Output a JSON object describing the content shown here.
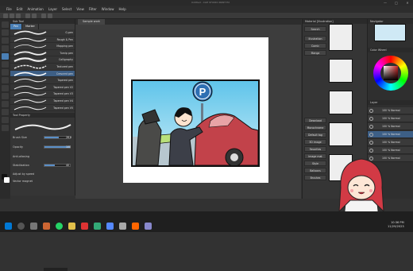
{
  "window": {
    "title": "Untitled - CLIP STUDIO PAINT EX",
    "controls": [
      "—",
      "□",
      "✕"
    ]
  },
  "menu": [
    "File",
    "Edit",
    "Animation",
    "Layer",
    "Select",
    "View",
    "Filter",
    "Window",
    "Help"
  ],
  "canvas_tab": {
    "label": "Sample work"
  },
  "brush_panel": {
    "header": "Sub Tool",
    "tabs": [
      "Pen",
      "Marker"
    ],
    "brushes": [
      {
        "label": "G-pen"
      },
      {
        "label": "Rough & Pen"
      },
      {
        "label": "Mapping pen"
      },
      {
        "label": "Turnip pen"
      },
      {
        "label": "Calligraphy"
      },
      {
        "label": "Textured pen"
      },
      {
        "label": "Crescent pen"
      },
      {
        "label": "Tapered pen"
      },
      {
        "label": "Tapered pen V2"
      },
      {
        "label": "Tapered pen V3"
      },
      {
        "label": "Tapered pen V4"
      },
      {
        "label": "Tapered pen V5"
      }
    ]
  },
  "tool_property": {
    "header": "Tool Property",
    "rows": [
      {
        "label": "Brush Size",
        "value": "26.0"
      },
      {
        "label": "Opacity",
        "value": "100"
      },
      {
        "label": "Anti-aliasing",
        "value": ""
      },
      {
        "label": "Stabilization",
        "value": "40"
      },
      {
        "label": "Adjust by speed",
        "value": ""
      },
      {
        "label": "Vector magnet",
        "value": ""
      }
    ]
  },
  "illustration": {
    "sign_letter": "P"
  },
  "material_panel": {
    "header": "Material [Illustration]",
    "side_buttons": [
      "Search",
      "Illustration",
      "Comic",
      "Manga",
      "Download",
      "Monochrome",
      "Default tag",
      "3D image",
      "Favorites",
      "Image mat",
      "Style",
      "Balloons",
      "Brushes"
    ]
  },
  "navigator": {
    "header": "Navigator"
  },
  "color_wheel": {
    "header": "Color Wheel"
  },
  "layers": {
    "header": "Layer",
    "items": [
      {
        "name": "100 % Normal"
      },
      {
        "name": "100 % Normal"
      },
      {
        "name": "100 % Normal"
      },
      {
        "name": "100 % Normal"
      },
      {
        "name": "100 % Normal"
      },
      {
        "name": "100 % Normal"
      },
      {
        "name": "100 % Normal"
      }
    ]
  },
  "taskbar": {
    "time": "10:36 PM",
    "date": "11/29/2023"
  },
  "colors": {
    "accent": "#4a7fb5",
    "bg": "#323232",
    "panel": "#353535"
  }
}
